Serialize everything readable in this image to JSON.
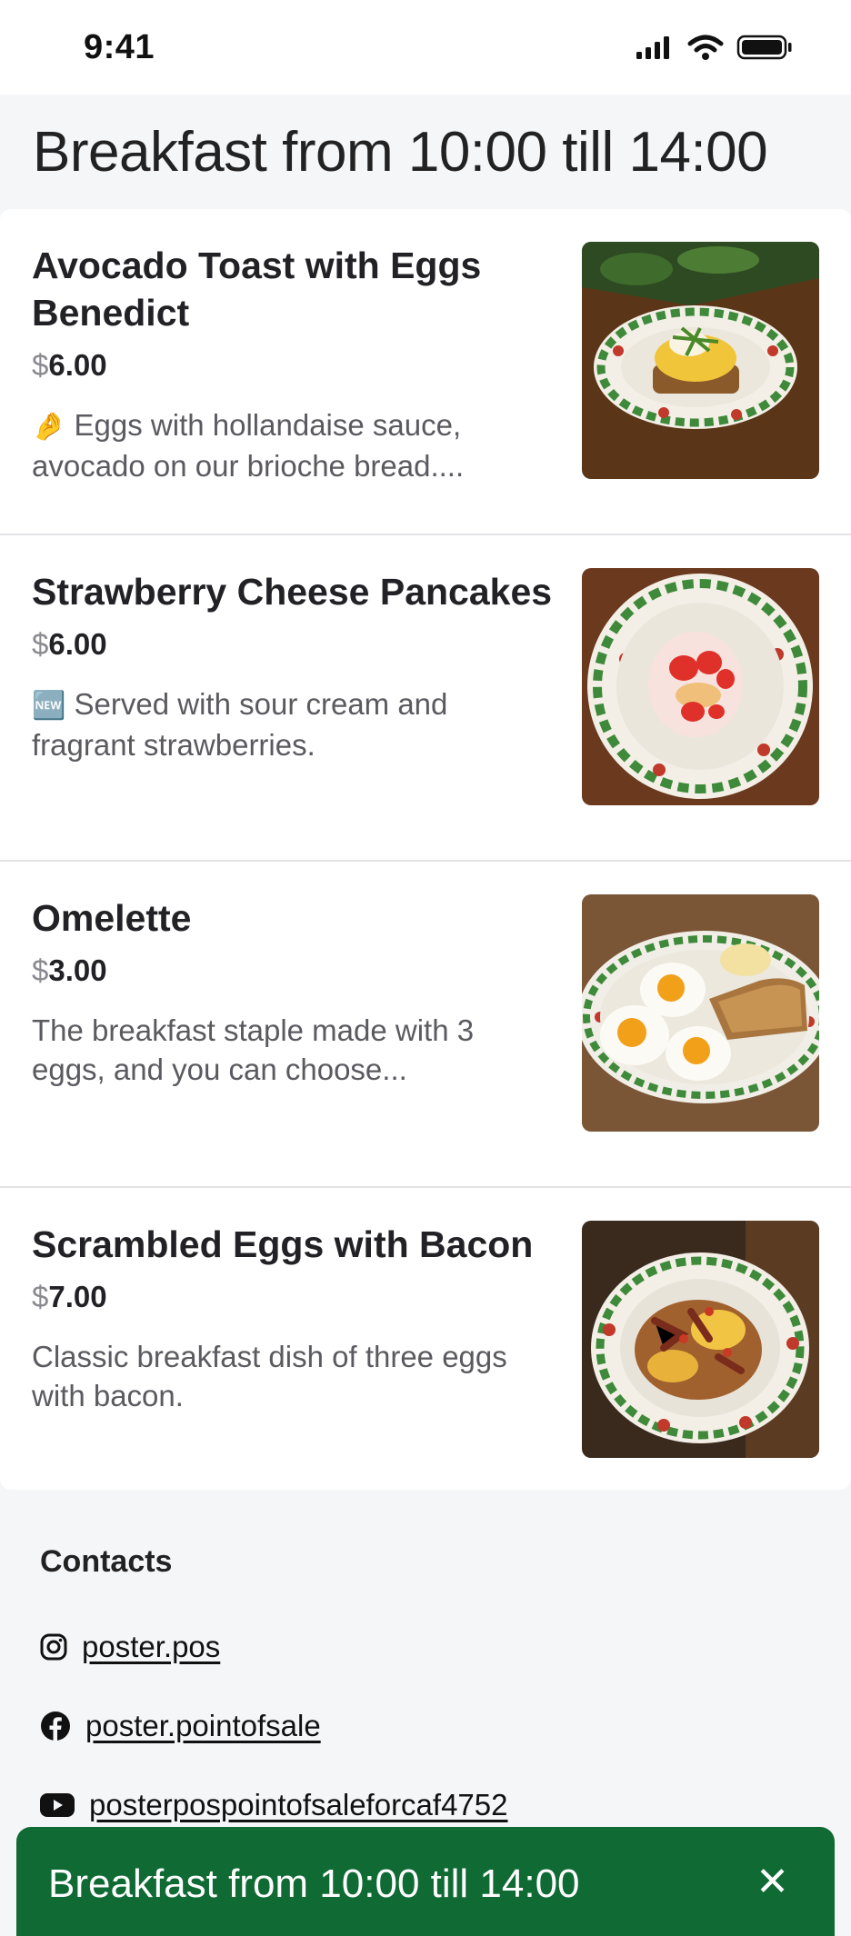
{
  "status_bar": {
    "time": "9:41"
  },
  "header": {
    "title": "Breakfast from 10:00 till 14:00"
  },
  "menu_items": [
    {
      "name": "Avocado Toast with Eggs Benedict",
      "currency": "$",
      "price": "6.00",
      "emoji": "🤌",
      "description": "Eggs with hollandaise sauce, avocado on our brioche bread...."
    },
    {
      "name": "Strawberry Cheese Pancakes",
      "currency": "$",
      "price": "6.00",
      "emoji": "🆕",
      "description": "Served with sour cream and fragrant strawberries."
    },
    {
      "name": "Omelette",
      "currency": "$",
      "price": "3.00",
      "description": "The breakfast staple made with 3 eggs, and you can choose..."
    },
    {
      "name": "Scrambled Eggs with Bacon",
      "currency": "$",
      "price": "7.00",
      "description": "Classic breakfast dish of three eggs with bacon."
    }
  ],
  "contacts": {
    "title": "Contacts",
    "instagram": "poster.pos",
    "facebook": "poster.pointofsale",
    "youtube": "posterpospointofsaleforcaf4752"
  },
  "banner": {
    "text": "Breakfast from 10:00 till 14:00",
    "close": "✕"
  },
  "colors": {
    "banner_green": "#0f6a33",
    "plate_red": "#c0392b",
    "plate_green": "#3f8a3a"
  }
}
